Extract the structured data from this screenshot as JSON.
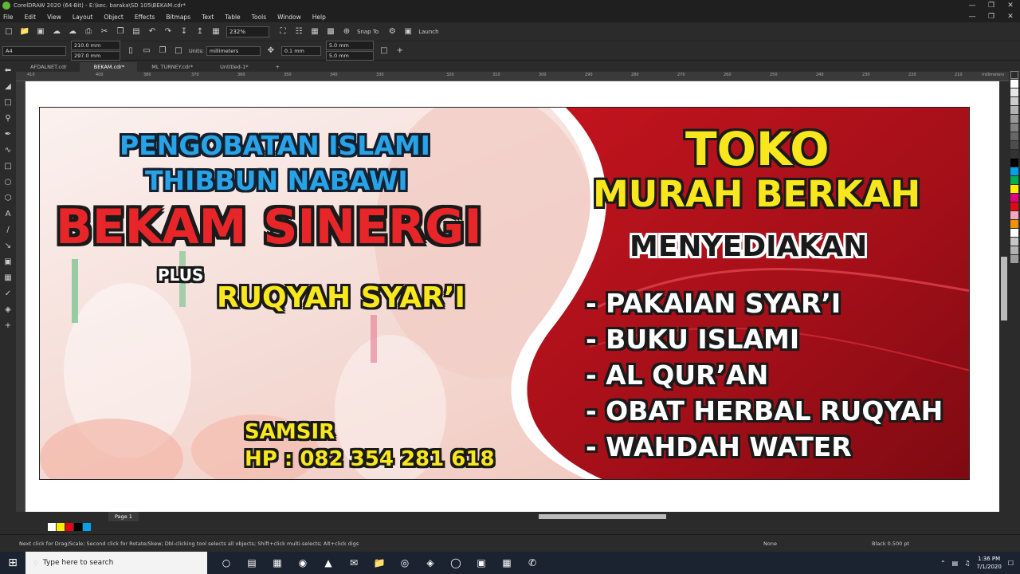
{
  "window": {
    "title": "CorelDRAW 2020 (64-Bit) - E:\\kec. baraka\\SD 105\\BEKAM.cdr*"
  },
  "menu": [
    "File",
    "Edit",
    "View",
    "Layout",
    "Object",
    "Effects",
    "Bitmaps",
    "Text",
    "Table",
    "Tools",
    "Window",
    "Help"
  ],
  "toolbar": {
    "zoom": "232%",
    "snap_label": "Snap To",
    "launch_label": "Launch"
  },
  "propbar": {
    "page_size": "A4",
    "width": "210.0 mm",
    "height": "297.0 mm",
    "units_label": "Units:",
    "units_value": "millimeters",
    "nudge": "0.1 mm",
    "dup_x": "5.0 mm",
    "dup_y": "5.0 mm"
  },
  "tabs": [
    "AFDALNET.cdr",
    "BEKAM.cdr*",
    "ML TURNEY.cdr*",
    "Untitled-1*"
  ],
  "ruler_ticks": [
    "410",
    "400",
    "380",
    "370",
    "360",
    "350",
    "340",
    "330",
    "320",
    "310",
    "300",
    "290",
    "280",
    "270",
    "260",
    "250",
    "240",
    "230",
    "220",
    "210"
  ],
  "ruler_unit": "millimeters",
  "banner": {
    "line1": "PENGOBATAN ISLAMI",
    "line2": "THIBBUN NABAWI",
    "line3": "BEKAM SINERGI",
    "plus": "PLUS",
    "ruqyah": "RUQYAH SYAR’I",
    "name": "SAMSIR",
    "phone": "HP : 082 354 281 618",
    "toko1": "TOKO",
    "toko2": "MURAH BERKAH",
    "menyediakan": "MENYEDIAKAN",
    "items": [
      "- PAKAIAN SYAR’I",
      "- BUKU ISLAMI",
      "- AL QUR’AN",
      "- OBAT HERBAL RUQYAH",
      "- WAHDAH WATER"
    ]
  },
  "page": {
    "label": "Page 1"
  },
  "status": {
    "hint": "Next click for Drag/Scale; Second click for Rotate/Skew; Dbl-clicking tool selects all objects; Shift+click multi-selects; Alt+click digs",
    "fill": "None",
    "outline": "Black  0.500 pt"
  },
  "taskbar": {
    "search_placeholder": "Type here to search",
    "time": "1:36 PM",
    "date": "7/1/2020"
  },
  "colors": {
    "red_panel": "#b3121e",
    "blue_text": "#29a3e8",
    "yellow_text": "#f8e71c",
    "red_text": "#e8262a"
  }
}
